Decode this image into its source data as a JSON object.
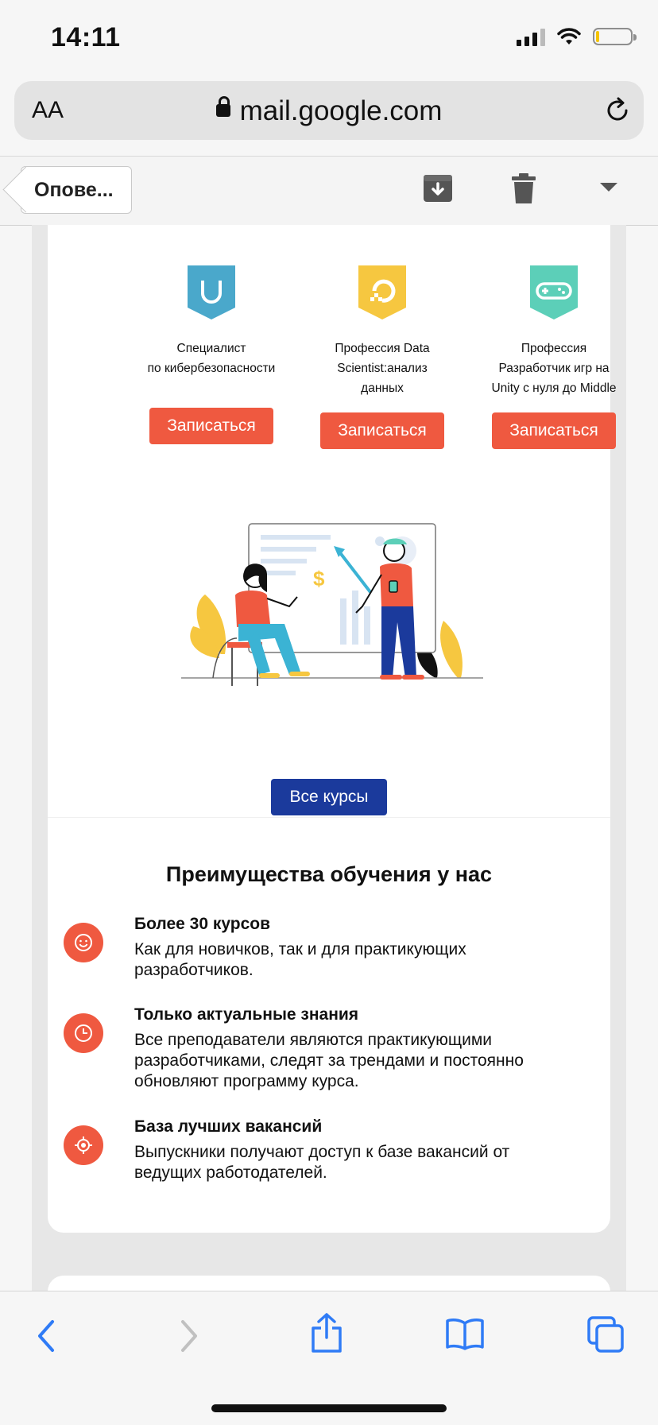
{
  "status_bar": {
    "time": "14:11",
    "battery_level": 0.08
  },
  "browser": {
    "text_size_label": "AA",
    "url": "mail.google.com"
  },
  "mail_toolbar": {
    "back_label": "Опове..."
  },
  "courses": [
    {
      "name_line1": "Специалист",
      "name_line2": "по кибербезопасности",
      "name_line3": "",
      "button": "Записаться",
      "badge_color": "#4aa8cb"
    },
    {
      "name_line1": "Профессия Data",
      "name_line2": "Scientist:анализ",
      "name_line3": "данных",
      "button": "Записаться",
      "badge_color": "#f6c740"
    },
    {
      "name_line1": "Профессия",
      "name_line2": "Разработчик игр на",
      "name_line3": "Unity с нуля до Middle",
      "button": "Записаться",
      "badge_color": "#5ccfb8"
    }
  ],
  "all_courses_button": "Все курсы",
  "advantages": {
    "title": "Преимущества обучения у нас",
    "items": [
      {
        "title": "Более 30 курсов",
        "text": "Как для новичков, так и для практикующих разработчиков."
      },
      {
        "title": "Только актуальные знания",
        "text": "Все преподаватели являются практикующими разработчиками, следят за трендами и постоянно обновляют программу курса."
      },
      {
        "title": "База лучших вакансий",
        "text": "Выпускники получают доступ к базе вакансий от ведущих работодателей."
      }
    ]
  },
  "colors": {
    "accent": "#ef5940",
    "primary_button": "#1b3a9c",
    "ios_blue": "#2f7bf6"
  }
}
